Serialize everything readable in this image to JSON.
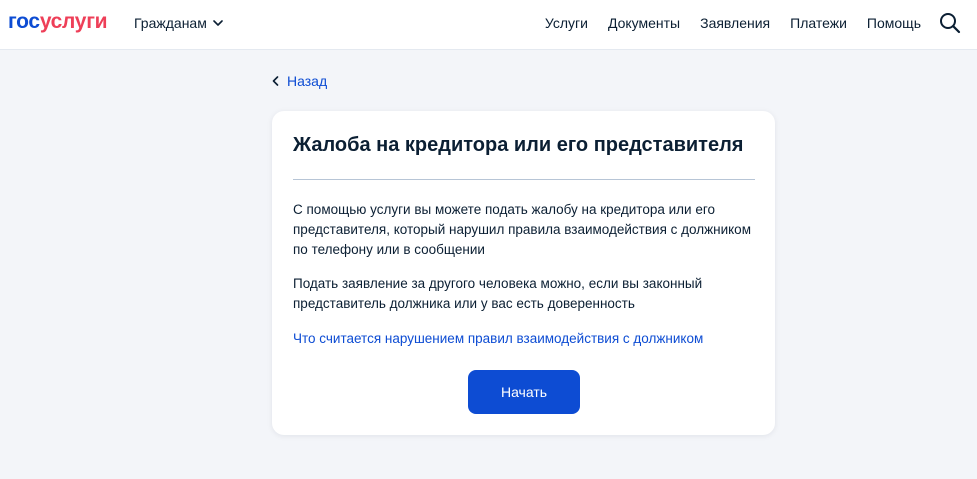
{
  "header": {
    "logo_part1": "гос",
    "logo_part2": "услуги",
    "citizen_label": "Гражданам",
    "nav": [
      "Услуги",
      "Документы",
      "Заявления",
      "Платежи",
      "Помощь"
    ],
    "search_icon": "search-icon",
    "chevron_icon": "chevron-down-icon"
  },
  "back": {
    "label": "Назад",
    "icon": "chevron-left-icon"
  },
  "card": {
    "title": "Жалоба на кредитора или его представителя",
    "paragraph1": "С помощью услуги вы можете подать жалобу на кредитора или его представителя, который нарушил правила взаимодействия с должником по телефону или в сообщении",
    "paragraph2": "Подать заявление за другого человека можно, если вы законный представитель должника или у вас есть доверенность",
    "link": "Что считается нарушением правил взаимодействия с должником",
    "button": "Начать"
  },
  "colors": {
    "primary": "#0d4cd3",
    "logo_red": "#ee3f58",
    "text": "#0b1f33",
    "background": "#f3f5f9"
  }
}
